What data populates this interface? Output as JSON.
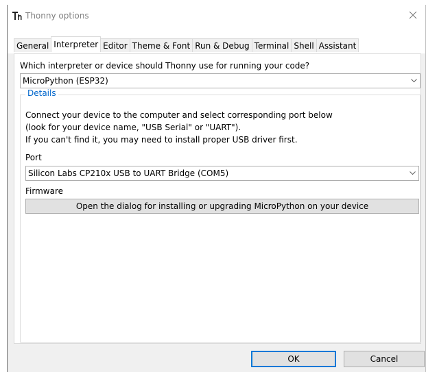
{
  "window": {
    "title": "Thonny options"
  },
  "tabs": [
    {
      "label": "General"
    },
    {
      "label": "Interpreter"
    },
    {
      "label": "Editor"
    },
    {
      "label": "Theme & Font"
    },
    {
      "label": "Run & Debug"
    },
    {
      "label": "Terminal"
    },
    {
      "label": "Shell"
    },
    {
      "label": "Assistant"
    }
  ],
  "active_tab": "Interpreter",
  "interpreter": {
    "question": "Which interpreter or device should Thonny use for running your code?",
    "selected": "MicroPython (ESP32)"
  },
  "details": {
    "label": "Details",
    "lines": [
      "Connect your device to the computer and select corresponding port below",
      "(look for your device name, \"USB Serial\" or \"UART\").",
      "If you can't find it, you may need to install proper USB driver first."
    ],
    "port_label": "Port",
    "port_selected": "Silicon Labs CP210x USB to UART Bridge (COM5)",
    "firmware_label": "Firmware",
    "firmware_button": "Open the dialog for installing or upgrading MicroPython on your device"
  },
  "footer": {
    "ok_label": "OK",
    "cancel_label": "Cancel"
  },
  "colors": {
    "accent": "#0066cc",
    "focus_border": "#0078d7"
  },
  "icons": {
    "logo": "thonny-logo-icon",
    "close": "close-icon",
    "dropdown": "chevron-down-icon"
  }
}
